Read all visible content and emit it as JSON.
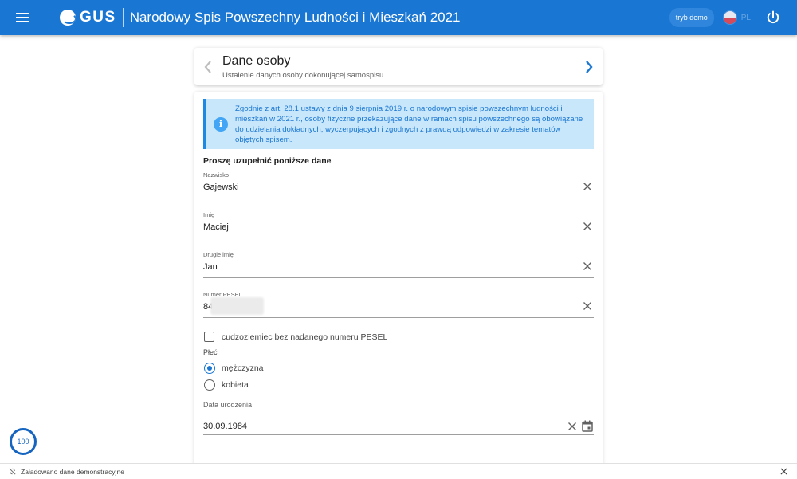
{
  "topbar": {
    "logo_text": "GUS",
    "app_title": "Narodowy Spis Powszechny Ludności i Mieszkań 2021",
    "demo_label": "tryb demo",
    "language": "PL",
    "icons": {
      "menu": "hamburger-icon",
      "power": "power-icon",
      "flag": "flag-icon"
    }
  },
  "header": {
    "title": "Dane osoby",
    "subtitle": "Ustalenie danych osoby dokonującej samospisu"
  },
  "info": {
    "text": "Zgodnie z art. 28.1 ustawy z dnia 9 sierpnia 2019 r. o narodowym spisie powszechnym ludności i mieszkań w 2021 r., osoby fizyczne przekazujące dane w ramach spisu powszechnego są obowiązane do udzielania dokładnych, wyczerpujących i zgodnych z prawdą odpowiedzi w zakresie tematów objętych spisem."
  },
  "form": {
    "heading": "Proszę uzupełnić poniższe dane",
    "fields": [
      {
        "label": "Nazwisko",
        "value": "Gajewski"
      },
      {
        "label": "Imię",
        "value": "Maciej"
      },
      {
        "label": "Drugie imię",
        "value": "Jan"
      },
      {
        "label": "Numer PESEL",
        "value": "84"
      }
    ],
    "foreigner_checkbox": {
      "label": "cudzoziemiec bez nadanego numeru PESEL",
      "checked": false
    },
    "gender": {
      "label": "Płeć",
      "options": [
        {
          "label": "mężczyzna",
          "selected": true
        },
        {
          "label": "kobieta",
          "selected": false
        }
      ]
    },
    "birth_date": {
      "label": "Data urodzenia",
      "value": "30.09.1984"
    }
  },
  "progress": {
    "value": "100"
  },
  "statusbar": {
    "text": "Załadowano dane demonstracyjne"
  },
  "colors": {
    "primary": "#1976d2",
    "info_bg": "#c9e7fb",
    "info_text": "#1976d2"
  }
}
